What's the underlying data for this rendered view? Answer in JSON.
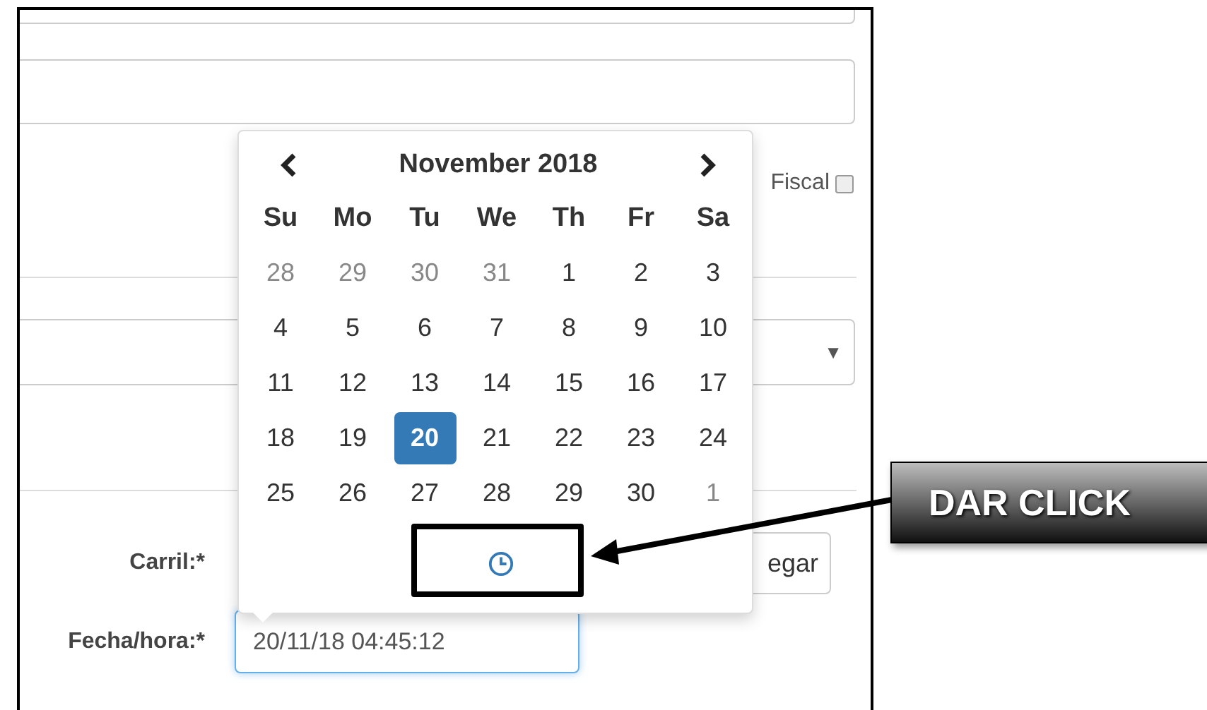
{
  "form": {
    "fiscal_label": "Fiscal",
    "fiscal_checked": false,
    "select_arrow": "▼",
    "carril_label": "Carril:*",
    "button_label": "egar",
    "fecha_label": "Fecha/hora:*",
    "fecha_value": "20/11/18 04:45:12"
  },
  "datepicker": {
    "title": "November 2018",
    "weekdays": [
      "Su",
      "Mo",
      "Tu",
      "We",
      "Th",
      "Fr",
      "Sa"
    ],
    "weeks": [
      [
        {
          "day": "28",
          "muted": true,
          "selected": false
        },
        {
          "day": "29",
          "muted": true,
          "selected": false
        },
        {
          "day": "30",
          "muted": true,
          "selected": false
        },
        {
          "day": "31",
          "muted": true,
          "selected": false
        },
        {
          "day": "1",
          "muted": false,
          "selected": false
        },
        {
          "day": "2",
          "muted": false,
          "selected": false
        },
        {
          "day": "3",
          "muted": false,
          "selected": false
        }
      ],
      [
        {
          "day": "4",
          "muted": false,
          "selected": false
        },
        {
          "day": "5",
          "muted": false,
          "selected": false
        },
        {
          "day": "6",
          "muted": false,
          "selected": false
        },
        {
          "day": "7",
          "muted": false,
          "selected": false
        },
        {
          "day": "8",
          "muted": false,
          "selected": false
        },
        {
          "day": "9",
          "muted": false,
          "selected": false
        },
        {
          "day": "10",
          "muted": false,
          "selected": false
        }
      ],
      [
        {
          "day": "11",
          "muted": false,
          "selected": false
        },
        {
          "day": "12",
          "muted": false,
          "selected": false
        },
        {
          "day": "13",
          "muted": false,
          "selected": false
        },
        {
          "day": "14",
          "muted": false,
          "selected": false
        },
        {
          "day": "15",
          "muted": false,
          "selected": false
        },
        {
          "day": "16",
          "muted": false,
          "selected": false
        },
        {
          "day": "17",
          "muted": false,
          "selected": false
        }
      ],
      [
        {
          "day": "18",
          "muted": false,
          "selected": false
        },
        {
          "day": "19",
          "muted": false,
          "selected": false
        },
        {
          "day": "20",
          "muted": false,
          "selected": true
        },
        {
          "day": "21",
          "muted": false,
          "selected": false
        },
        {
          "day": "22",
          "muted": false,
          "selected": false
        },
        {
          "day": "23",
          "muted": false,
          "selected": false
        },
        {
          "day": "24",
          "muted": false,
          "selected": false
        }
      ],
      [
        {
          "day": "25",
          "muted": false,
          "selected": false
        },
        {
          "day": "26",
          "muted": false,
          "selected": false
        },
        {
          "day": "27",
          "muted": false,
          "selected": false
        },
        {
          "day": "28",
          "muted": false,
          "selected": false
        },
        {
          "day": "29",
          "muted": false,
          "selected": false
        },
        {
          "day": "30",
          "muted": false,
          "selected": false
        },
        {
          "day": "1",
          "muted": true,
          "selected": false
        }
      ]
    ]
  },
  "callout": {
    "text": "DAR CLICK"
  }
}
